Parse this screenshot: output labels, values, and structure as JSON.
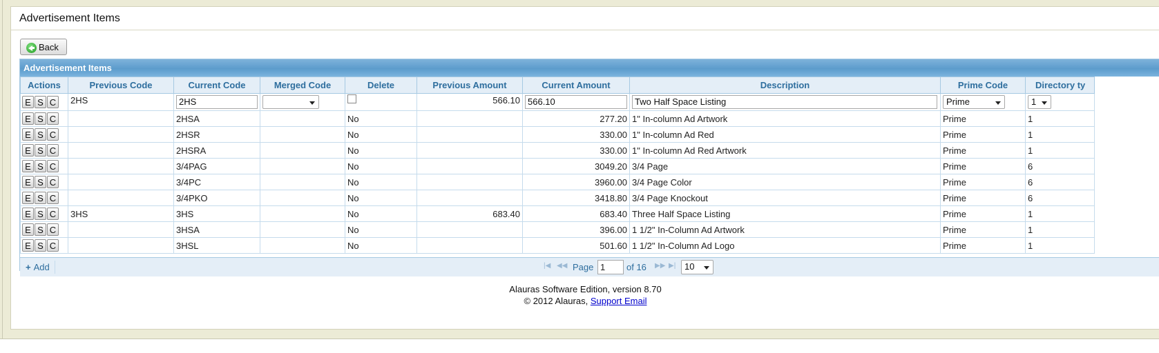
{
  "page": {
    "title": "Advertisement Items",
    "back_label": "Back"
  },
  "grid": {
    "caption": "Advertisement Items",
    "columns": [
      "Actions",
      "Previous Code",
      "Current Code",
      "Merged Code",
      "Delete",
      "Previous Amount",
      "Current Amount",
      "Description",
      "Prime Code",
      "Directory ty"
    ],
    "action_buttons": [
      "E",
      "S",
      "C"
    ],
    "edit_row": {
      "previous_code": "2HS",
      "current_code": "2HS",
      "merged_code": "",
      "previous_amount": "566.10",
      "current_amount": "566.10",
      "description": "Two Half Space Listing",
      "prime_code": "Prime",
      "directory_type": "1"
    },
    "rows": [
      {
        "previous_code": "",
        "current_code": "2HSA",
        "merged_code": "",
        "delete": "No",
        "previous_amount": "",
        "current_amount": "277.20",
        "description": "1\" In-column Ad  Artwork",
        "prime_code": "Prime",
        "directory_type": "1"
      },
      {
        "previous_code": "",
        "current_code": "2HSR",
        "merged_code": "",
        "delete": "No",
        "previous_amount": "",
        "current_amount": "330.00",
        "description": "1\" In-column Ad Red",
        "prime_code": "Prime",
        "directory_type": "1"
      },
      {
        "previous_code": "",
        "current_code": "2HSRA",
        "merged_code": "",
        "delete": "No",
        "previous_amount": "",
        "current_amount": "330.00",
        "description": "1\" In-column Ad Red Artwork",
        "prime_code": "Prime",
        "directory_type": "1"
      },
      {
        "previous_code": "",
        "current_code": "3/4PAG",
        "merged_code": "",
        "delete": "No",
        "previous_amount": "",
        "current_amount": "3049.20",
        "description": "3/4 Page",
        "prime_code": "Prime",
        "directory_type": "6"
      },
      {
        "previous_code": "",
        "current_code": "3/4PC",
        "merged_code": "",
        "delete": "No",
        "previous_amount": "",
        "current_amount": "3960.00",
        "description": "3/4 Page Color",
        "prime_code": "Prime",
        "directory_type": "6"
      },
      {
        "previous_code": "",
        "current_code": "3/4PKO",
        "merged_code": "",
        "delete": "No",
        "previous_amount": "",
        "current_amount": "3418.80",
        "description": "3/4 Page Knockout",
        "prime_code": "Prime",
        "directory_type": "6"
      },
      {
        "previous_code": "3HS",
        "current_code": "3HS",
        "merged_code": "",
        "delete": "No",
        "previous_amount": "683.40",
        "current_amount": "683.40",
        "description": "Three Half Space Listing",
        "prime_code": "Prime",
        "directory_type": "1"
      },
      {
        "previous_code": "",
        "current_code": "3HSA",
        "merged_code": "",
        "delete": "No",
        "previous_amount": "",
        "current_amount": "396.00",
        "description": "1 1/2\" In-Column Ad Artwork",
        "prime_code": "Prime",
        "directory_type": "1"
      },
      {
        "previous_code": "",
        "current_code": "3HSL",
        "merged_code": "",
        "delete": "No",
        "previous_amount": "",
        "current_amount": "501.60",
        "description": "1 1/2\" In-Column Ad Logo",
        "prime_code": "Prime",
        "directory_type": "1"
      }
    ]
  },
  "pager": {
    "add_label": "Add",
    "page_label": "Page",
    "current_page": "1",
    "of_label": "of 16",
    "page_size": "10",
    "first_icon": "first-page-icon",
    "prev_icon": "prev-page-icon",
    "next_icon": "next-page-icon",
    "last_icon": "last-page-icon"
  },
  "footer": {
    "edition": "Alauras Software Edition, version 8.70",
    "copyright": "© 2012 Alauras,",
    "support_link": "Support Email"
  }
}
